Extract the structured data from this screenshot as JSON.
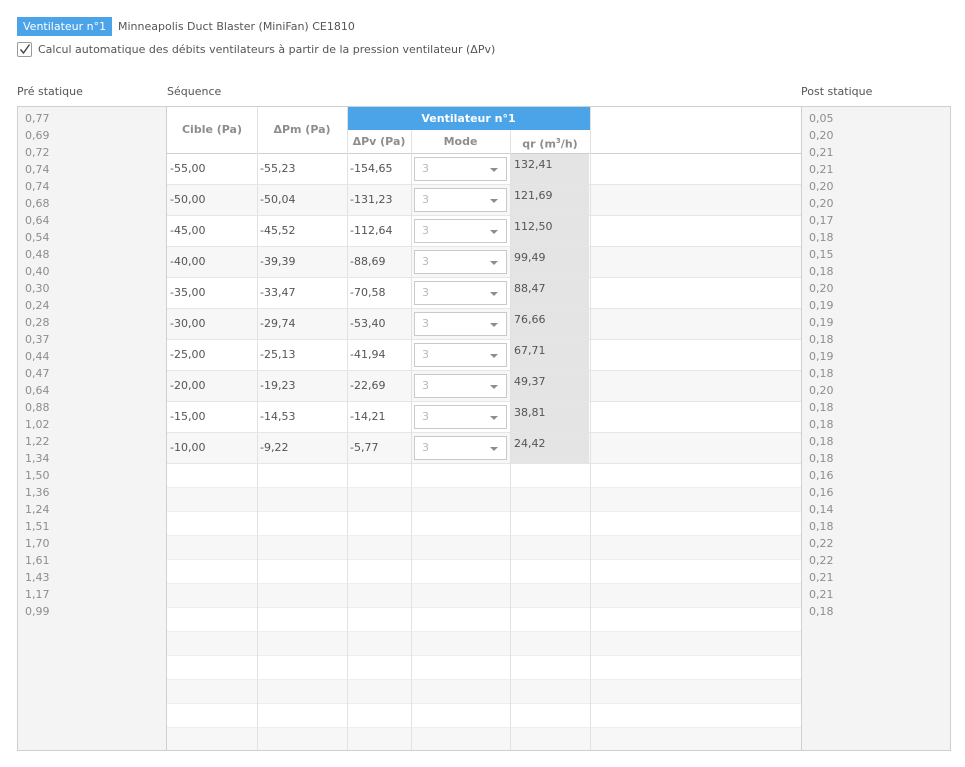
{
  "header": {
    "fan_tag": "Ventilateur n°1",
    "fan_name": "Minneapolis Duct Blaster (MiniFan) CE1810",
    "auto_label": "Calcul automatique des débits ventilateurs à partir de la pression ventilateur (ΔPv)",
    "auto_checked": true
  },
  "labels": {
    "pre": "Pré statique",
    "seq": "Séquence",
    "post": "Post statique"
  },
  "pre_values": [
    "0,77",
    "0,69",
    "0,72",
    "0,74",
    "0,74",
    "0,68",
    "0,64",
    "0,54",
    "0,48",
    "0,40",
    "0,30",
    "0,24",
    "0,28",
    "0,37",
    "0,44",
    "0,47",
    "0,64",
    "0,88",
    "1,02",
    "1,22",
    "1,34",
    "1,50",
    "1,36",
    "1,24",
    "1,51",
    "1,70",
    "1,61",
    "1,43",
    "1,17",
    "0,99"
  ],
  "post_values": [
    "0,05",
    "0,20",
    "0,21",
    "0,21",
    "0,20",
    "0,20",
    "0,17",
    "0,18",
    "0,15",
    "0,18",
    "0,20",
    "0,19",
    "0,19",
    "0,18",
    "0,19",
    "0,18",
    "0,20",
    "0,18",
    "0,18",
    "0,18",
    "0,18",
    "0,16",
    "0,16",
    "0,14",
    "0,18",
    "0,22",
    "0,22",
    "0,21",
    "0,21",
    "0,18"
  ],
  "table": {
    "group_header": "Ventilateur n°1",
    "col_cible": "Cible (Pa)",
    "col_dpm": "ΔPm (Pa)",
    "col_dpv": "ΔPv (Pa)",
    "col_mode": "Mode",
    "col_qr_main": "qr (m",
    "col_qr_sup": "3",
    "col_qr_tail": "/h)",
    "rows": [
      {
        "cible": "-55,00",
        "dpm": "-55,23",
        "dpv": "-154,65",
        "mode": "3",
        "qr": "132,41"
      },
      {
        "cible": "-50,00",
        "dpm": "-50,04",
        "dpv": "-131,23",
        "mode": "3",
        "qr": "121,69"
      },
      {
        "cible": "-45,00",
        "dpm": "-45,52",
        "dpv": "-112,64",
        "mode": "3",
        "qr": "112,50"
      },
      {
        "cible": "-40,00",
        "dpm": "-39,39",
        "dpv": "-88,69",
        "mode": "3",
        "qr": "99,49"
      },
      {
        "cible": "-35,00",
        "dpm": "-33,47",
        "dpv": "-70,58",
        "mode": "3",
        "qr": "88,47"
      },
      {
        "cible": "-30,00",
        "dpm": "-29,74",
        "dpv": "-53,40",
        "mode": "3",
        "qr": "76,66"
      },
      {
        "cible": "-25,00",
        "dpm": "-25,13",
        "dpv": "-41,94",
        "mode": "3",
        "qr": "67,71"
      },
      {
        "cible": "-20,00",
        "dpm": "-19,23",
        "dpv": "-22,69",
        "mode": "3",
        "qr": "49,37"
      },
      {
        "cible": "-15,00",
        "dpm": "-14,53",
        "dpv": "-14,21",
        "mode": "3",
        "qr": "38,81"
      },
      {
        "cible": "-10,00",
        "dpm": "-9,22",
        "dpv": "-5,77",
        "mode": "3",
        "qr": "24,42"
      }
    ]
  },
  "colors": {
    "accent": "#4ba3e8",
    "qr_bg": "#e4e4e4",
    "panel_bg": "#f4f4f4"
  }
}
